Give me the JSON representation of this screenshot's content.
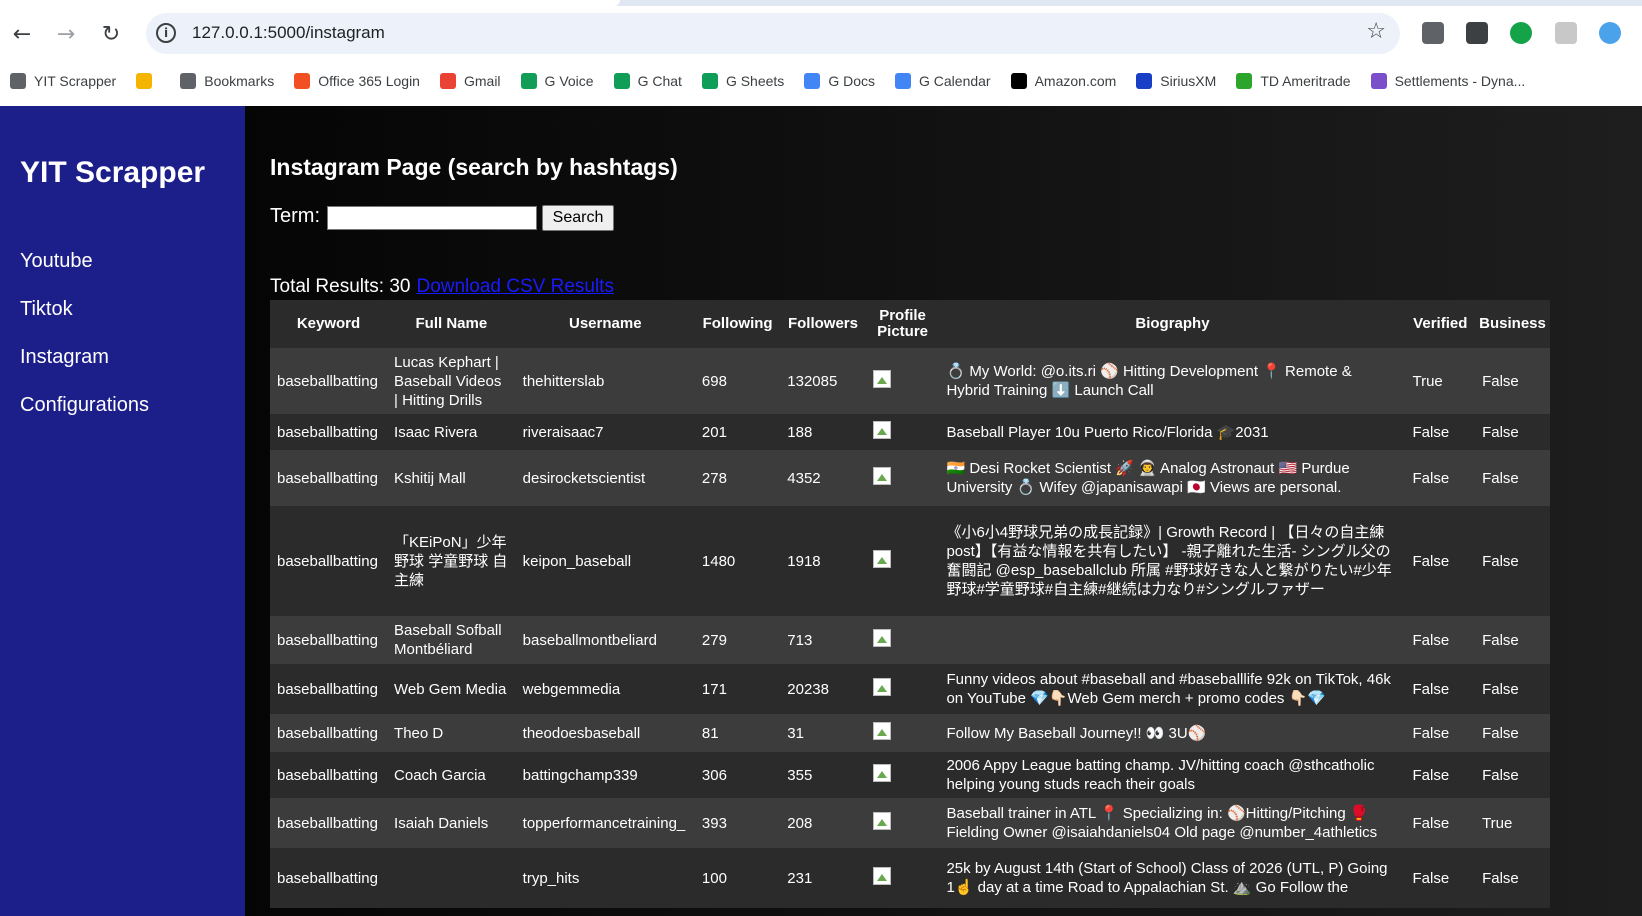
{
  "browser": {
    "url": "127.0.0.1:5000/instagram",
    "bookmarks": [
      {
        "label": "YIT Scrapper",
        "icon": "globe-icon",
        "color": "#5f6368"
      },
      {
        "label": "",
        "icon": "pinwheel-icon",
        "color": "#f4b400"
      },
      {
        "label": "Bookmarks",
        "icon": "star-icon",
        "color": "#5f6368"
      },
      {
        "label": "Office 365 Login",
        "icon": "office-icon",
        "color": "#f25022"
      },
      {
        "label": "Gmail",
        "icon": "gmail-icon",
        "color": "#ea4335"
      },
      {
        "label": "G Voice",
        "icon": "phone-icon",
        "color": "#0f9d58"
      },
      {
        "label": "G Chat",
        "icon": "chat-icon",
        "color": "#0f9d58"
      },
      {
        "label": "G Sheets",
        "icon": "sheets-icon",
        "color": "#0f9d58"
      },
      {
        "label": "G Docs",
        "icon": "docs-icon",
        "color": "#4285f4"
      },
      {
        "label": "G Calendar",
        "icon": "calendar-icon",
        "color": "#4285f4"
      },
      {
        "label": "Amazon.com",
        "icon": "amazon-icon",
        "color": "#000000"
      },
      {
        "label": "SiriusXM",
        "icon": "siriusxm-icon",
        "color": "#1a3fc7"
      },
      {
        "label": "TD Ameritrade",
        "icon": "td-icon",
        "color": "#2ba52b"
      },
      {
        "label": "Settlements - Dyna...",
        "icon": "settlements-icon",
        "color": "#7b4fc9"
      }
    ]
  },
  "app": {
    "brand": "YIT Scrapper",
    "nav": [
      "Youtube",
      "Tiktok",
      "Instagram",
      "Configurations"
    ],
    "title": "Instagram Page (search by hashtags)",
    "term_label": "Term:",
    "term_value": "",
    "search_label": "Search",
    "total_label": "Total Results: 30",
    "download_label": "Download CSV Results"
  },
  "table": {
    "headers": [
      "Keyword",
      "Full Name",
      "Username",
      "Following",
      "Followers",
      "Profile Picture",
      "Biography",
      "Verified",
      "Business"
    ],
    "rows": [
      {
        "keyword": "baseballbatting",
        "full_name": "Lucas Kephart | Baseball Videos | Hitting Drills",
        "username": "thehitterslab",
        "following": "698",
        "followers": "132085",
        "bio": "💍 My World: @o.its.ri ⚾ Hitting Development 📍 Remote & Hybrid Training ⬇️ Launch Call",
        "verified": "True",
        "business": "False"
      },
      {
        "keyword": "baseballbatting",
        "full_name": "Isaac Rivera",
        "username": "riveraisaac7",
        "following": "201",
        "followers": "188",
        "bio": "Baseball Player 10u Puerto Rico/Florida 🎓2031",
        "verified": "False",
        "business": "False"
      },
      {
        "keyword": "baseballbatting",
        "full_name": "Kshitij Mall",
        "username": "desirocketscientist",
        "following": "278",
        "followers": "4352",
        "bio": "🇮🇳 Desi Rocket Scientist 🚀 👨‍🚀 Analog Astronaut 🇺🇸 Purdue University 💍 Wifey @japanisawapi 🇯🇵 Views are personal.",
        "verified": "False",
        "business": "False"
      },
      {
        "keyword": "baseballbatting",
        "full_name": "「KEiPoN」少年野球 学童野球 自主練",
        "username": "keipon_baseball",
        "following": "1480",
        "followers": "1918",
        "bio": "《小6小4野球兄弟の成長記録》| Growth Record | 【日々の自主練post】【有益な情報を共有したい】 -親子離れた生活- シングル父の奮闘記 @esp_baseballclub 所属 #野球好きな人と繋がりたい#少年野球#学童野球#自主練#継続は力なり#シングルファザー",
        "verified": "False",
        "business": "False"
      },
      {
        "keyword": "baseballbatting",
        "full_name": "Baseball Sofball Montbéliard",
        "username": "baseballmontbeliard",
        "following": "279",
        "followers": "713",
        "bio": "",
        "verified": "False",
        "business": "False"
      },
      {
        "keyword": "baseballbatting",
        "full_name": "Web Gem Media",
        "username": "webgemmedia",
        "following": "171",
        "followers": "20238",
        "bio": "Funny videos about #baseball and #baseballlife 92k on TikTok, 46k on YouTube 💎👇🏻Web Gem merch + promo codes 👇🏻💎",
        "verified": "False",
        "business": "False"
      },
      {
        "keyword": "baseballbatting",
        "full_name": "Theo D",
        "username": "theodoesbaseball",
        "following": "81",
        "followers": "31",
        "bio": "Follow My Baseball Journey!! 👀 3U⚾",
        "verified": "False",
        "business": "False"
      },
      {
        "keyword": "baseballbatting",
        "full_name": "Coach Garcia",
        "username": "battingchamp339",
        "following": "306",
        "followers": "355",
        "bio": "2006 Appy League batting champ. JV/hitting coach @sthcatholic helping young studs reach their goals",
        "verified": "False",
        "business": "False"
      },
      {
        "keyword": "baseballbatting",
        "full_name": "Isaiah Daniels",
        "username": "topperformancetraining_",
        "following": "393",
        "followers": "208",
        "bio": "Baseball trainer in ATL 📍 Specializing in: ⚾Hitting/Pitching 🥊 Fielding Owner @isaiahdaniels04 Old page @number_4athletics",
        "verified": "False",
        "business": "True"
      },
      {
        "keyword": "baseballbatting",
        "full_name": "",
        "username": "tryp_hits",
        "following": "100",
        "followers": "231",
        "bio": "25k by August 14th (Start of School) Class of 2026 (UTL, P) Going 1☝️ day at a time Road to Appalachian St. ⛰️ Go Follow the",
        "verified": "False",
        "business": "False"
      }
    ]
  }
}
